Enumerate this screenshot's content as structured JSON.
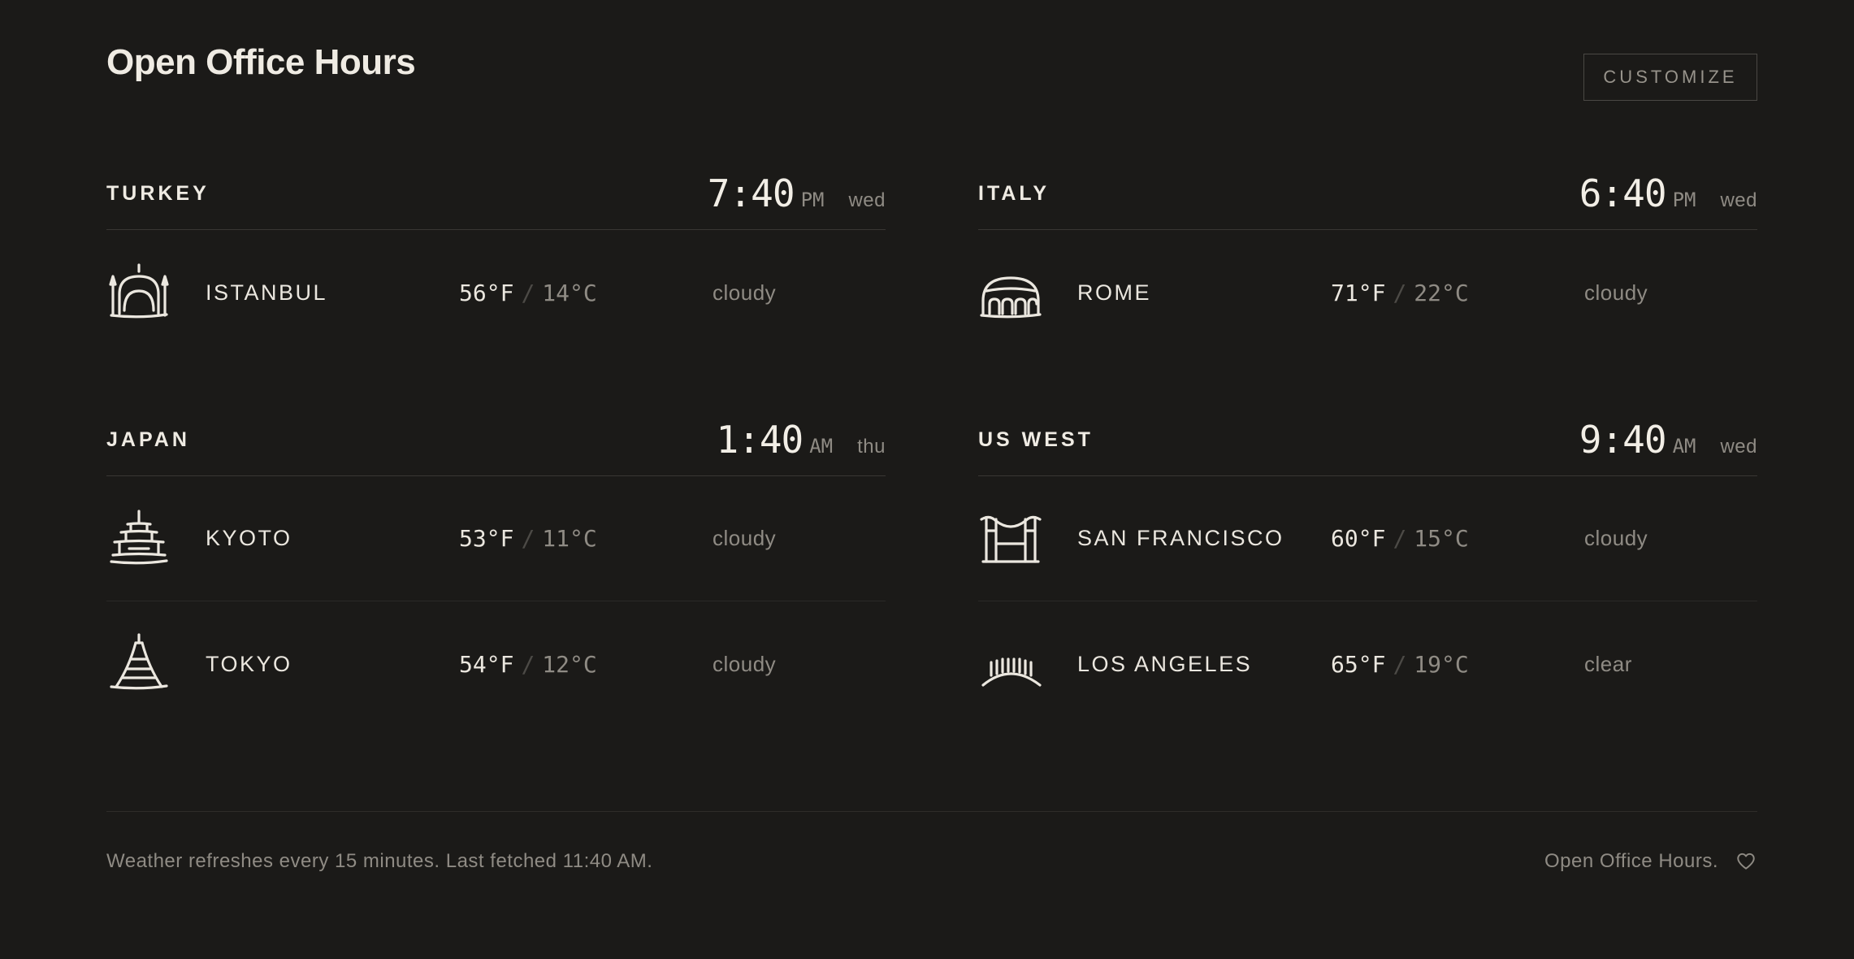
{
  "app": {
    "title": "Open Office Hours",
    "customize_label": "CUSTOMIZE"
  },
  "groups": [
    {
      "region": "TURKEY",
      "time": "7:40",
      "ampm": "PM",
      "day": "wed",
      "cities": [
        {
          "name": "ISTANBUL",
          "icon": "mosque-icon",
          "temp_f": "56°F",
          "temp_c": "14°C",
          "condition": "cloudy"
        }
      ]
    },
    {
      "region": "ITALY",
      "time": "6:40",
      "ampm": "PM",
      "day": "wed",
      "cities": [
        {
          "name": "ROME",
          "icon": "colosseum-icon",
          "temp_f": "71°F",
          "temp_c": "22°C",
          "condition": "cloudy"
        }
      ]
    },
    {
      "region": "JAPAN",
      "time": "1:40",
      "ampm": "AM",
      "day": "thu",
      "cities": [
        {
          "name": "KYOTO",
          "icon": "pagoda-icon",
          "temp_f": "53°F",
          "temp_c": "11°C",
          "condition": "cloudy"
        },
        {
          "name": "TOKYO",
          "icon": "tokyo-tower-icon",
          "temp_f": "54°F",
          "temp_c": "12°C",
          "condition": "cloudy"
        }
      ]
    },
    {
      "region": "US WEST",
      "time": "9:40",
      "ampm": "AM",
      "day": "wed",
      "cities": [
        {
          "name": "SAN FRANCISCO",
          "icon": "golden-gate-bridge-icon",
          "temp_f": "60°F",
          "temp_c": "15°C",
          "condition": "cloudy"
        },
        {
          "name": "LOS ANGELES",
          "icon": "hollywood-bowl-icon",
          "temp_f": "65°F",
          "temp_c": "19°C",
          "condition": "clear"
        }
      ]
    }
  ],
  "footer": {
    "note": "Weather refreshes every 15 minutes. Last fetched 11:40 AM.",
    "brand": "Open Office Hours.",
    "icon": "heart-icon"
  },
  "colors": {
    "background": "#1b1a18",
    "text": "#ebe7df",
    "muted": "#8f8b84",
    "divider": "#393734"
  }
}
